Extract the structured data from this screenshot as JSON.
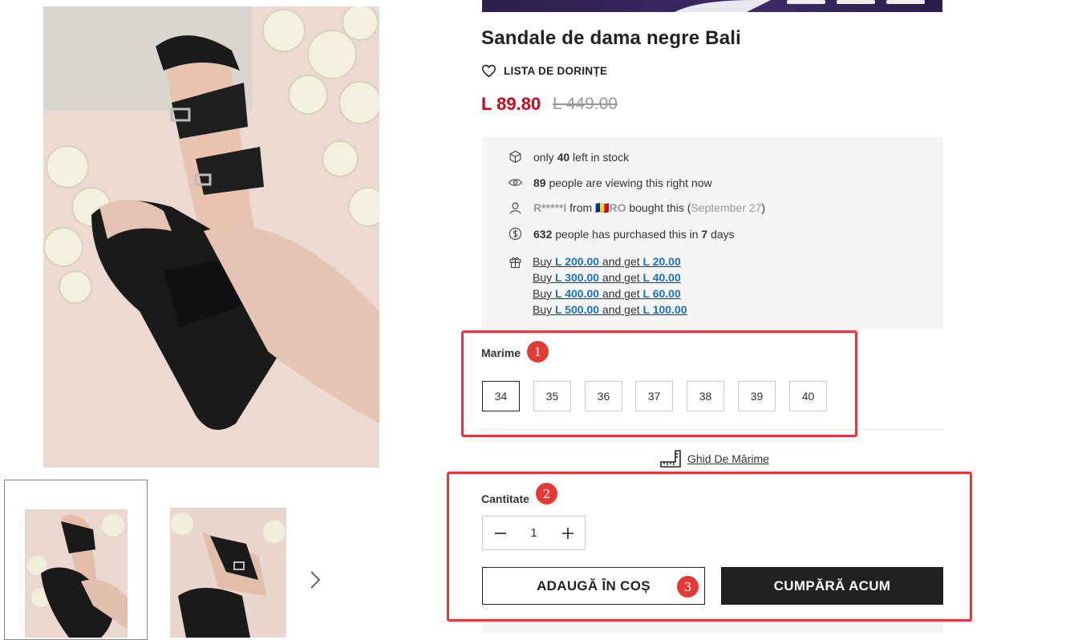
{
  "product": {
    "title": "Sandale de dama negre Bali",
    "wishlist_label": "LISTA DE DORINȚE",
    "price": "L 89.80",
    "old_price": "L 449.00"
  },
  "info": {
    "stock": {
      "pre": "only",
      "count": "40",
      "post": "left in stock"
    },
    "viewing": {
      "count": "89",
      "post": "people are viewing this right now"
    },
    "recent": {
      "name": "R*****l",
      "from": "from",
      "flag": "🇷🇴",
      "country": "RO",
      "bought": "bought this (",
      "date": "September 27",
      "close": ")"
    },
    "purchased": {
      "count": "632",
      "mid": "people has purchased this in",
      "days": "7",
      "post": "days"
    },
    "offers": [
      {
        "buy": "Buy",
        "spend": "L 200.00",
        "and": "and get",
        "get": "L 20.00"
      },
      {
        "buy": "Buy",
        "spend": "L 300.00",
        "and": "and get",
        "get": "L 40.00"
      },
      {
        "buy": "Buy",
        "spend": "L 400.00",
        "and": "and get",
        "get": "L 60.00"
      },
      {
        "buy": "Buy",
        "spend": "L 500.00",
        "and": "and get",
        "get": "L 100.00"
      }
    ]
  },
  "size": {
    "label": "Marime",
    "options": [
      "34",
      "35",
      "36",
      "37",
      "38",
      "39",
      "40"
    ],
    "selected": "34",
    "guide_label": "Ghid De Mărime"
  },
  "quantity": {
    "label": "Cantitate",
    "value": "1"
  },
  "actions": {
    "add_to_cart": "ADAUGĂ ÎN COȘ",
    "buy_now": "CUMPĂRĂ ACUM"
  },
  "annotations": [
    "1",
    "2",
    "3"
  ],
  "colors": {
    "price": "#d0021b",
    "link": "#1a73c8",
    "annotation": "#e53935",
    "button_dark": "#222222"
  }
}
